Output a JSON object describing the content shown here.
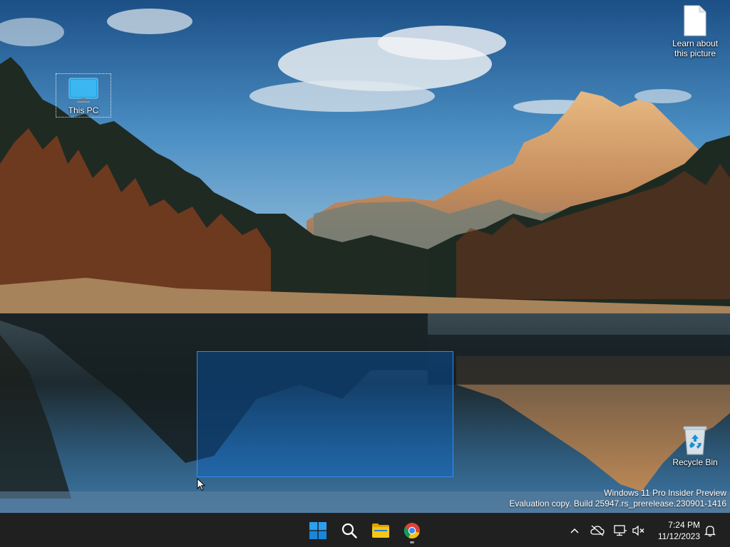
{
  "desktop": {
    "icons": [
      {
        "label": "This PC",
        "icon": "monitor-icon"
      },
      {
        "label": "Learn about this picture",
        "icon": "document-icon"
      },
      {
        "label": "Recycle Bin",
        "icon": "recycle-bin-icon"
      }
    ]
  },
  "watermark": {
    "line1": "Windows 11 Pro Insider Preview",
    "line2": "Evaluation copy. Build 25947.rs_prerelease.230901-1416"
  },
  "taskbar": {
    "apps": [
      {
        "name": "Start",
        "icon": "windows-logo-icon"
      },
      {
        "name": "Search",
        "icon": "search-icon"
      },
      {
        "name": "File Explorer",
        "icon": "folder-icon"
      },
      {
        "name": "Google Chrome",
        "icon": "chrome-icon"
      }
    ],
    "tray": {
      "icons": [
        "chevron-up-icon",
        "cloud-offline-icon",
        "network-icon",
        "volume-muted-icon",
        "notification-bell-icon"
      ],
      "time": "7:24 PM",
      "date": "11/12/2023"
    }
  },
  "colors": {
    "taskbar": "#202020",
    "selection": "#0066cc",
    "windows_blue": "#0078d4",
    "folder_yellow": "#f5c518"
  }
}
